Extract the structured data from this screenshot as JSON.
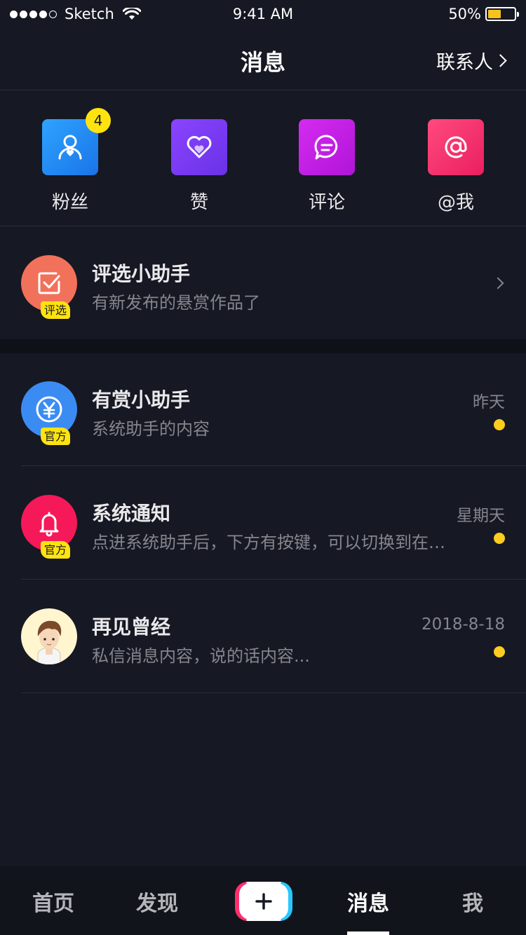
{
  "status_bar": {
    "carrier": "Sketch",
    "time": "9:41 AM",
    "battery_percent": "50%",
    "battery_level": 0.5
  },
  "nav": {
    "title": "消息",
    "contacts_label": "联系人"
  },
  "quick_actions": [
    {
      "label": "粉丝",
      "icon": "fans-icon",
      "color": "#1f8cf3",
      "badge": "4"
    },
    {
      "label": "赞",
      "icon": "heart-icon",
      "color": "#7a3ff2"
    },
    {
      "label": "评论",
      "icon": "comment-icon",
      "color": "#c61ee6"
    },
    {
      "label": "@我",
      "icon": "at-icon",
      "color": "#f52f6e"
    }
  ],
  "featured": {
    "title": "评选小助手",
    "subtitle": "有新发布的悬赏作品了",
    "tag": "评选",
    "avatar_color": "#f2715b"
  },
  "messages": [
    {
      "title": "有赏小助手",
      "subtitle": "系统助手的内容",
      "time": "昨天",
      "tag": "官方",
      "avatar_color": "#3b8cf2",
      "unread": true
    },
    {
      "title": "系统通知",
      "subtitle": "点进系统助手后，下方有按键，可以切换到在…",
      "time": "星期天",
      "tag": "官方",
      "avatar_color": "#f5195a",
      "unread": true
    },
    {
      "title": "再见曾经",
      "subtitle": "私信消息内容，说的话内容...",
      "time": "2018-8-18",
      "avatar_color": "#fff6cf",
      "unread": true
    }
  ],
  "tabbar": {
    "home": "首页",
    "discover": "发现",
    "messages": "消息",
    "me": "我",
    "active": "消息"
  },
  "colors": {
    "background": "#161823",
    "accent_yellow": "#ffe30f",
    "unread_dot": "#ffcc1f"
  }
}
